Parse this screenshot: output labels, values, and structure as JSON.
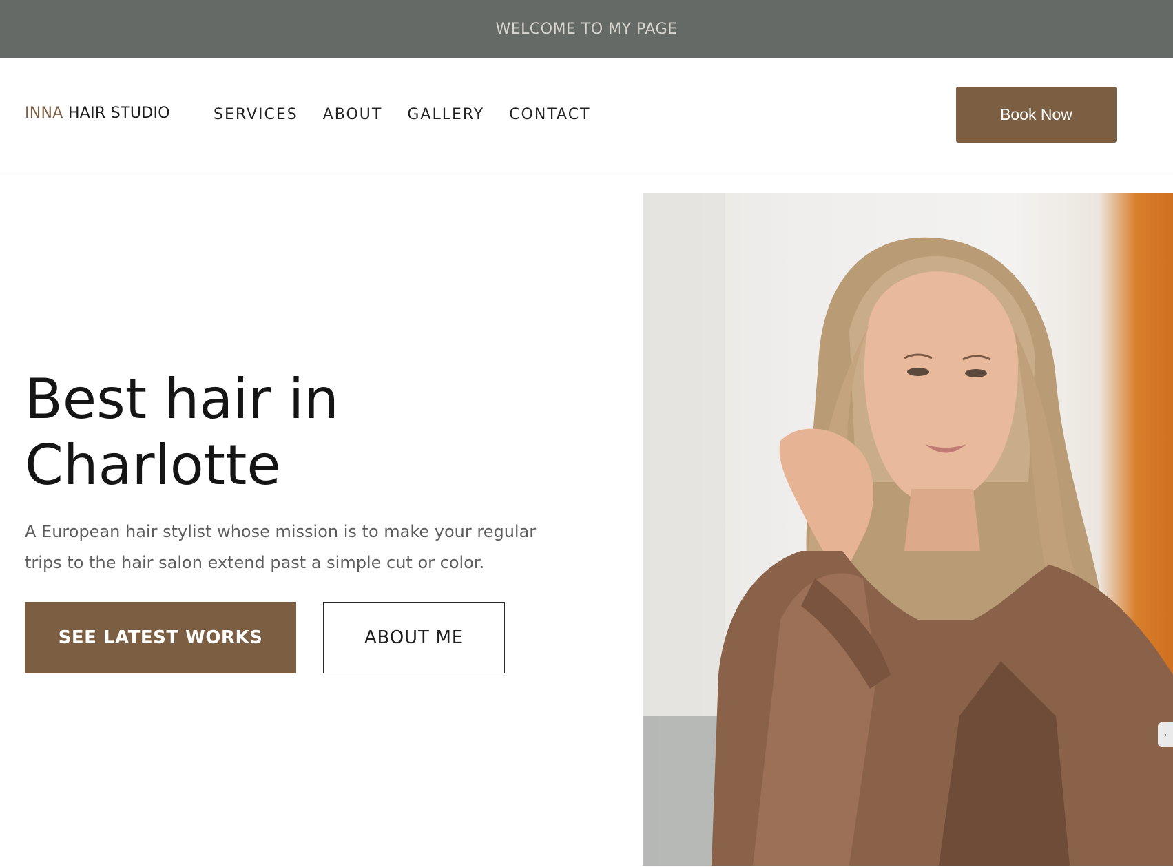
{
  "announcement": {
    "text": "WELCOME TO MY PAGE"
  },
  "header": {
    "logo_accent": "INNA",
    "logo_rest": " HAIR STUDIO",
    "nav": [
      {
        "label": "SERVICES"
      },
      {
        "label": "ABOUT"
      },
      {
        "label": "GALLERY"
      },
      {
        "label": "CONTACT"
      }
    ],
    "book_button": "Book Now"
  },
  "hero": {
    "title_line1": "Best hair in",
    "title_line2": "Charlotte",
    "subtitle": "A European hair stylist whose mission is to make your regular trips to the hair salon extend past a simple cut or color.",
    "primary_button": "SEE LATEST WORKS",
    "secondary_button": "ABOUT ME"
  },
  "side_widget": {
    "icon": "chevron-right-icon"
  },
  "colors": {
    "accent": "#7c5e42",
    "topbar_bg": "#656a67",
    "topbar_text": "#d9d6cf"
  }
}
